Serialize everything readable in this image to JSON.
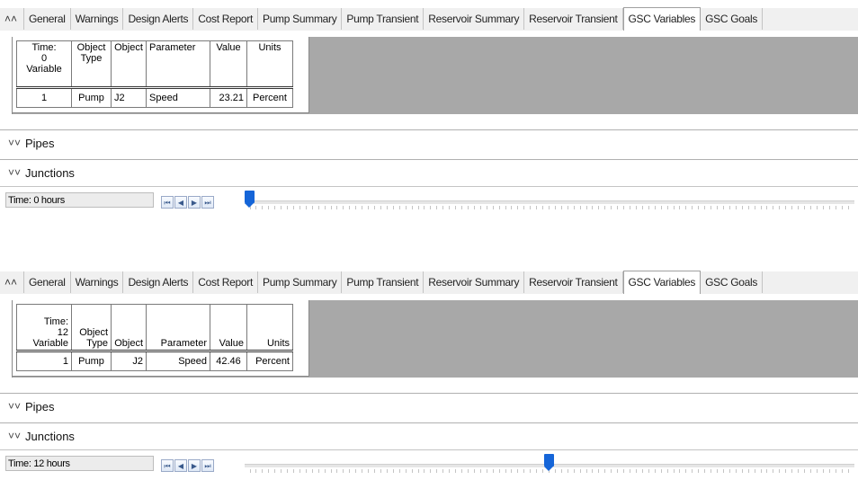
{
  "tabs": [
    "General",
    "Warnings",
    "Design Alerts",
    "Cost Report",
    "Pump Summary",
    "Pump Transient",
    "Reservoir Summary",
    "Reservoir Transient",
    "GSC Variables",
    "GSC Goals"
  ],
  "active_tab": "GSC Variables",
  "sections": {
    "pipes": "Pipes",
    "junctions": "Junctions"
  },
  "icons": {
    "collapse": "chevron-up-icon",
    "expand": "chevron-down-icon"
  },
  "accent_color": "#1565d8",
  "panels": [
    {
      "header": {
        "variable_1": "Time:",
        "variable_2": "0",
        "variable_3": "Variable",
        "object_type": "Object Type",
        "object": "Object",
        "parameter": "Parameter",
        "value": "Value",
        "units": "Units"
      },
      "row": {
        "variable": "1",
        "object_type": "Pump",
        "object": "J2",
        "parameter": "Speed",
        "value": "23.21",
        "units": "Percent"
      },
      "time_label": "Time: 0 hours",
      "time_fraction": 0.0
    },
    {
      "header": {
        "variable_1": "Time:",
        "variable_2": "12",
        "variable_3": "Variable",
        "object_type": "Object Type",
        "object": "Object",
        "parameter": "Parameter",
        "value": "Value",
        "units": "Units"
      },
      "row": {
        "variable": "1",
        "object_type": "Pump",
        "object": "J2",
        "parameter": "Speed",
        "value": "42.46",
        "units": "Percent"
      },
      "time_label": "Time: 12 hours",
      "time_fraction": 0.5
    }
  ]
}
